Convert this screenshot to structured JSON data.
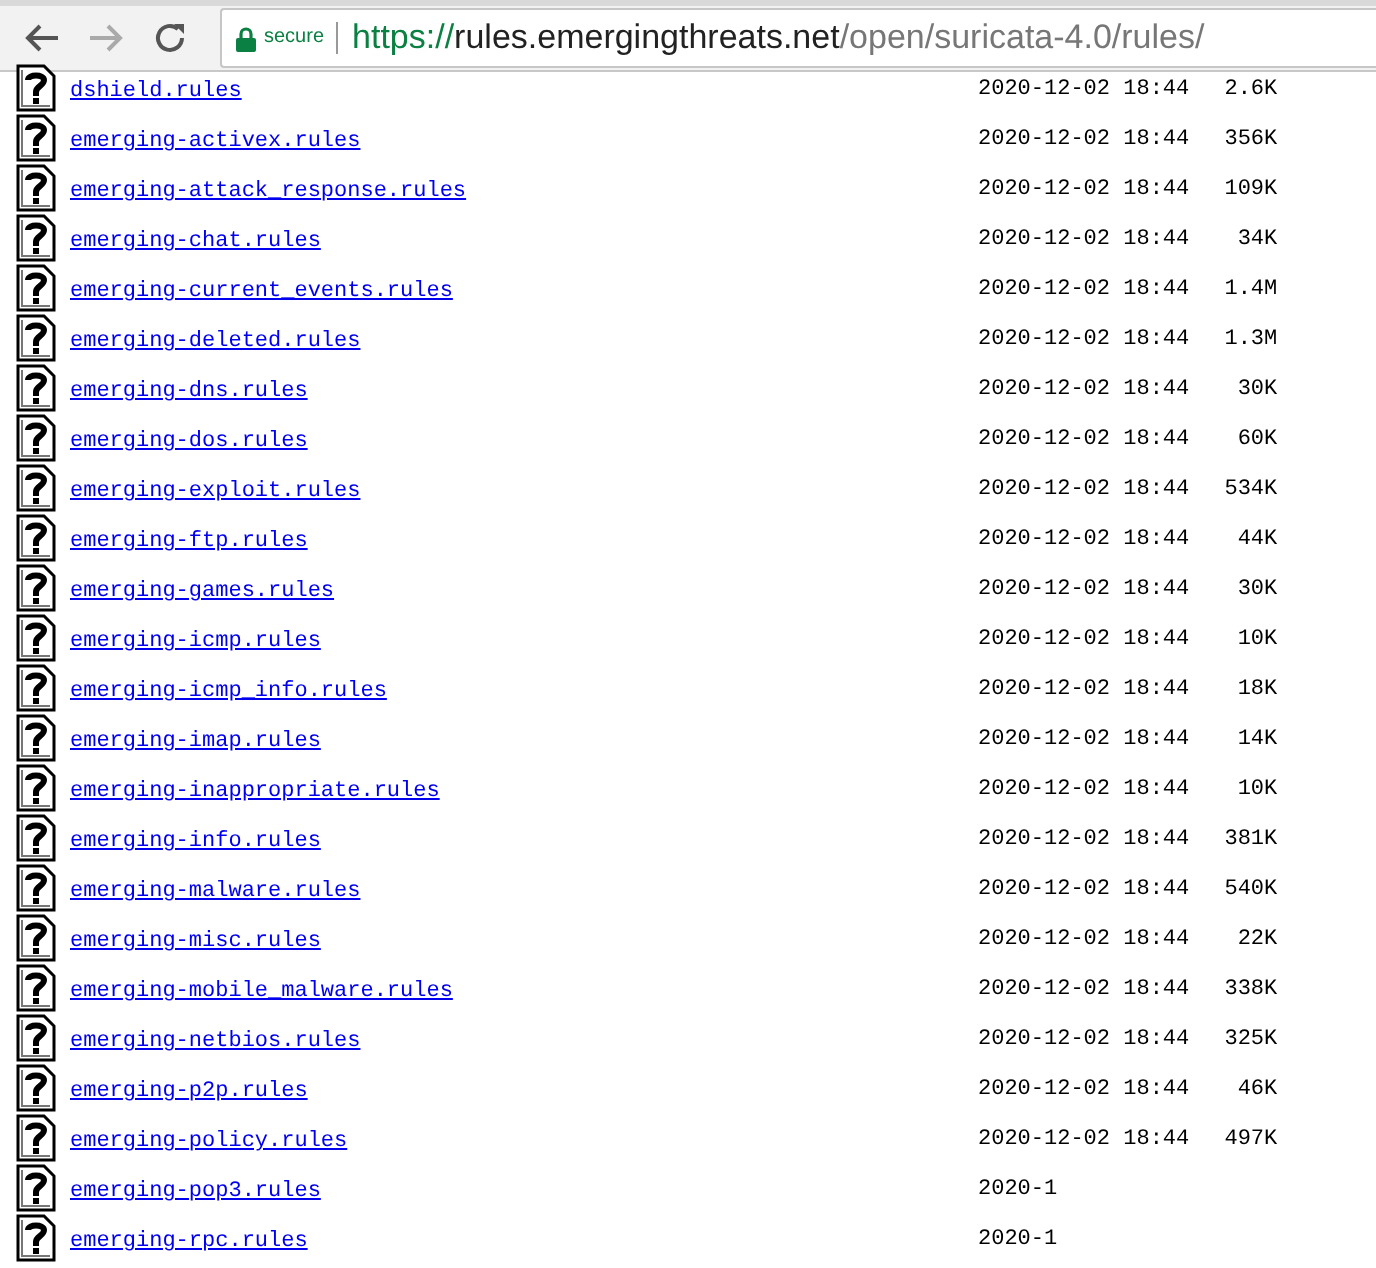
{
  "toolbar": {
    "security_label": "secure",
    "url": {
      "scheme": "https://",
      "host": "rules.emergingthreats.net",
      "path": "/open/suricata-4.0/rules/"
    }
  },
  "listing": [
    {
      "name": "dshield.rules",
      "date": "2020-12-02 18:44",
      "size": "2.6K"
    },
    {
      "name": "emerging-activex.rules",
      "date": "2020-12-02 18:44",
      "size": "356K"
    },
    {
      "name": "emerging-attack_response.rules",
      "date": "2020-12-02 18:44",
      "size": "109K"
    },
    {
      "name": "emerging-chat.rules",
      "date": "2020-12-02 18:44",
      "size": "34K"
    },
    {
      "name": "emerging-current_events.rules",
      "date": "2020-12-02 18:44",
      "size": "1.4M"
    },
    {
      "name": "emerging-deleted.rules",
      "date": "2020-12-02 18:44",
      "size": "1.3M"
    },
    {
      "name": "emerging-dns.rules",
      "date": "2020-12-02 18:44",
      "size": "30K"
    },
    {
      "name": "emerging-dos.rules",
      "date": "2020-12-02 18:44",
      "size": "60K"
    },
    {
      "name": "emerging-exploit.rules",
      "date": "2020-12-02 18:44",
      "size": "534K"
    },
    {
      "name": "emerging-ftp.rules",
      "date": "2020-12-02 18:44",
      "size": "44K"
    },
    {
      "name": "emerging-games.rules",
      "date": "2020-12-02 18:44",
      "size": "30K"
    },
    {
      "name": "emerging-icmp.rules",
      "date": "2020-12-02 18:44",
      "size": "10K"
    },
    {
      "name": "emerging-icmp_info.rules",
      "date": "2020-12-02 18:44",
      "size": "18K"
    },
    {
      "name": "emerging-imap.rules",
      "date": "2020-12-02 18:44",
      "size": "14K"
    },
    {
      "name": "emerging-inappropriate.rules",
      "date": "2020-12-02 18:44",
      "size": "10K"
    },
    {
      "name": "emerging-info.rules",
      "date": "2020-12-02 18:44",
      "size": "381K"
    },
    {
      "name": "emerging-malware.rules",
      "date": "2020-12-02 18:44",
      "size": "540K"
    },
    {
      "name": "emerging-misc.rules",
      "date": "2020-12-02 18:44",
      "size": "22K"
    },
    {
      "name": "emerging-mobile_malware.rules",
      "date": "2020-12-02 18:44",
      "size": "338K"
    },
    {
      "name": "emerging-netbios.rules",
      "date": "2020-12-02 18:44",
      "size": "325K"
    },
    {
      "name": "emerging-p2p.rules",
      "date": "2020-12-02 18:44",
      "size": "46K"
    },
    {
      "name": "emerging-policy.rules",
      "date": "2020-12-02 18:44",
      "size": "497K"
    },
    {
      "name": "emerging-pop3.rules",
      "date": "2020-1"
    },
    {
      "name": "emerging-rpc.rules",
      "date": "2020-1"
    }
  ]
}
